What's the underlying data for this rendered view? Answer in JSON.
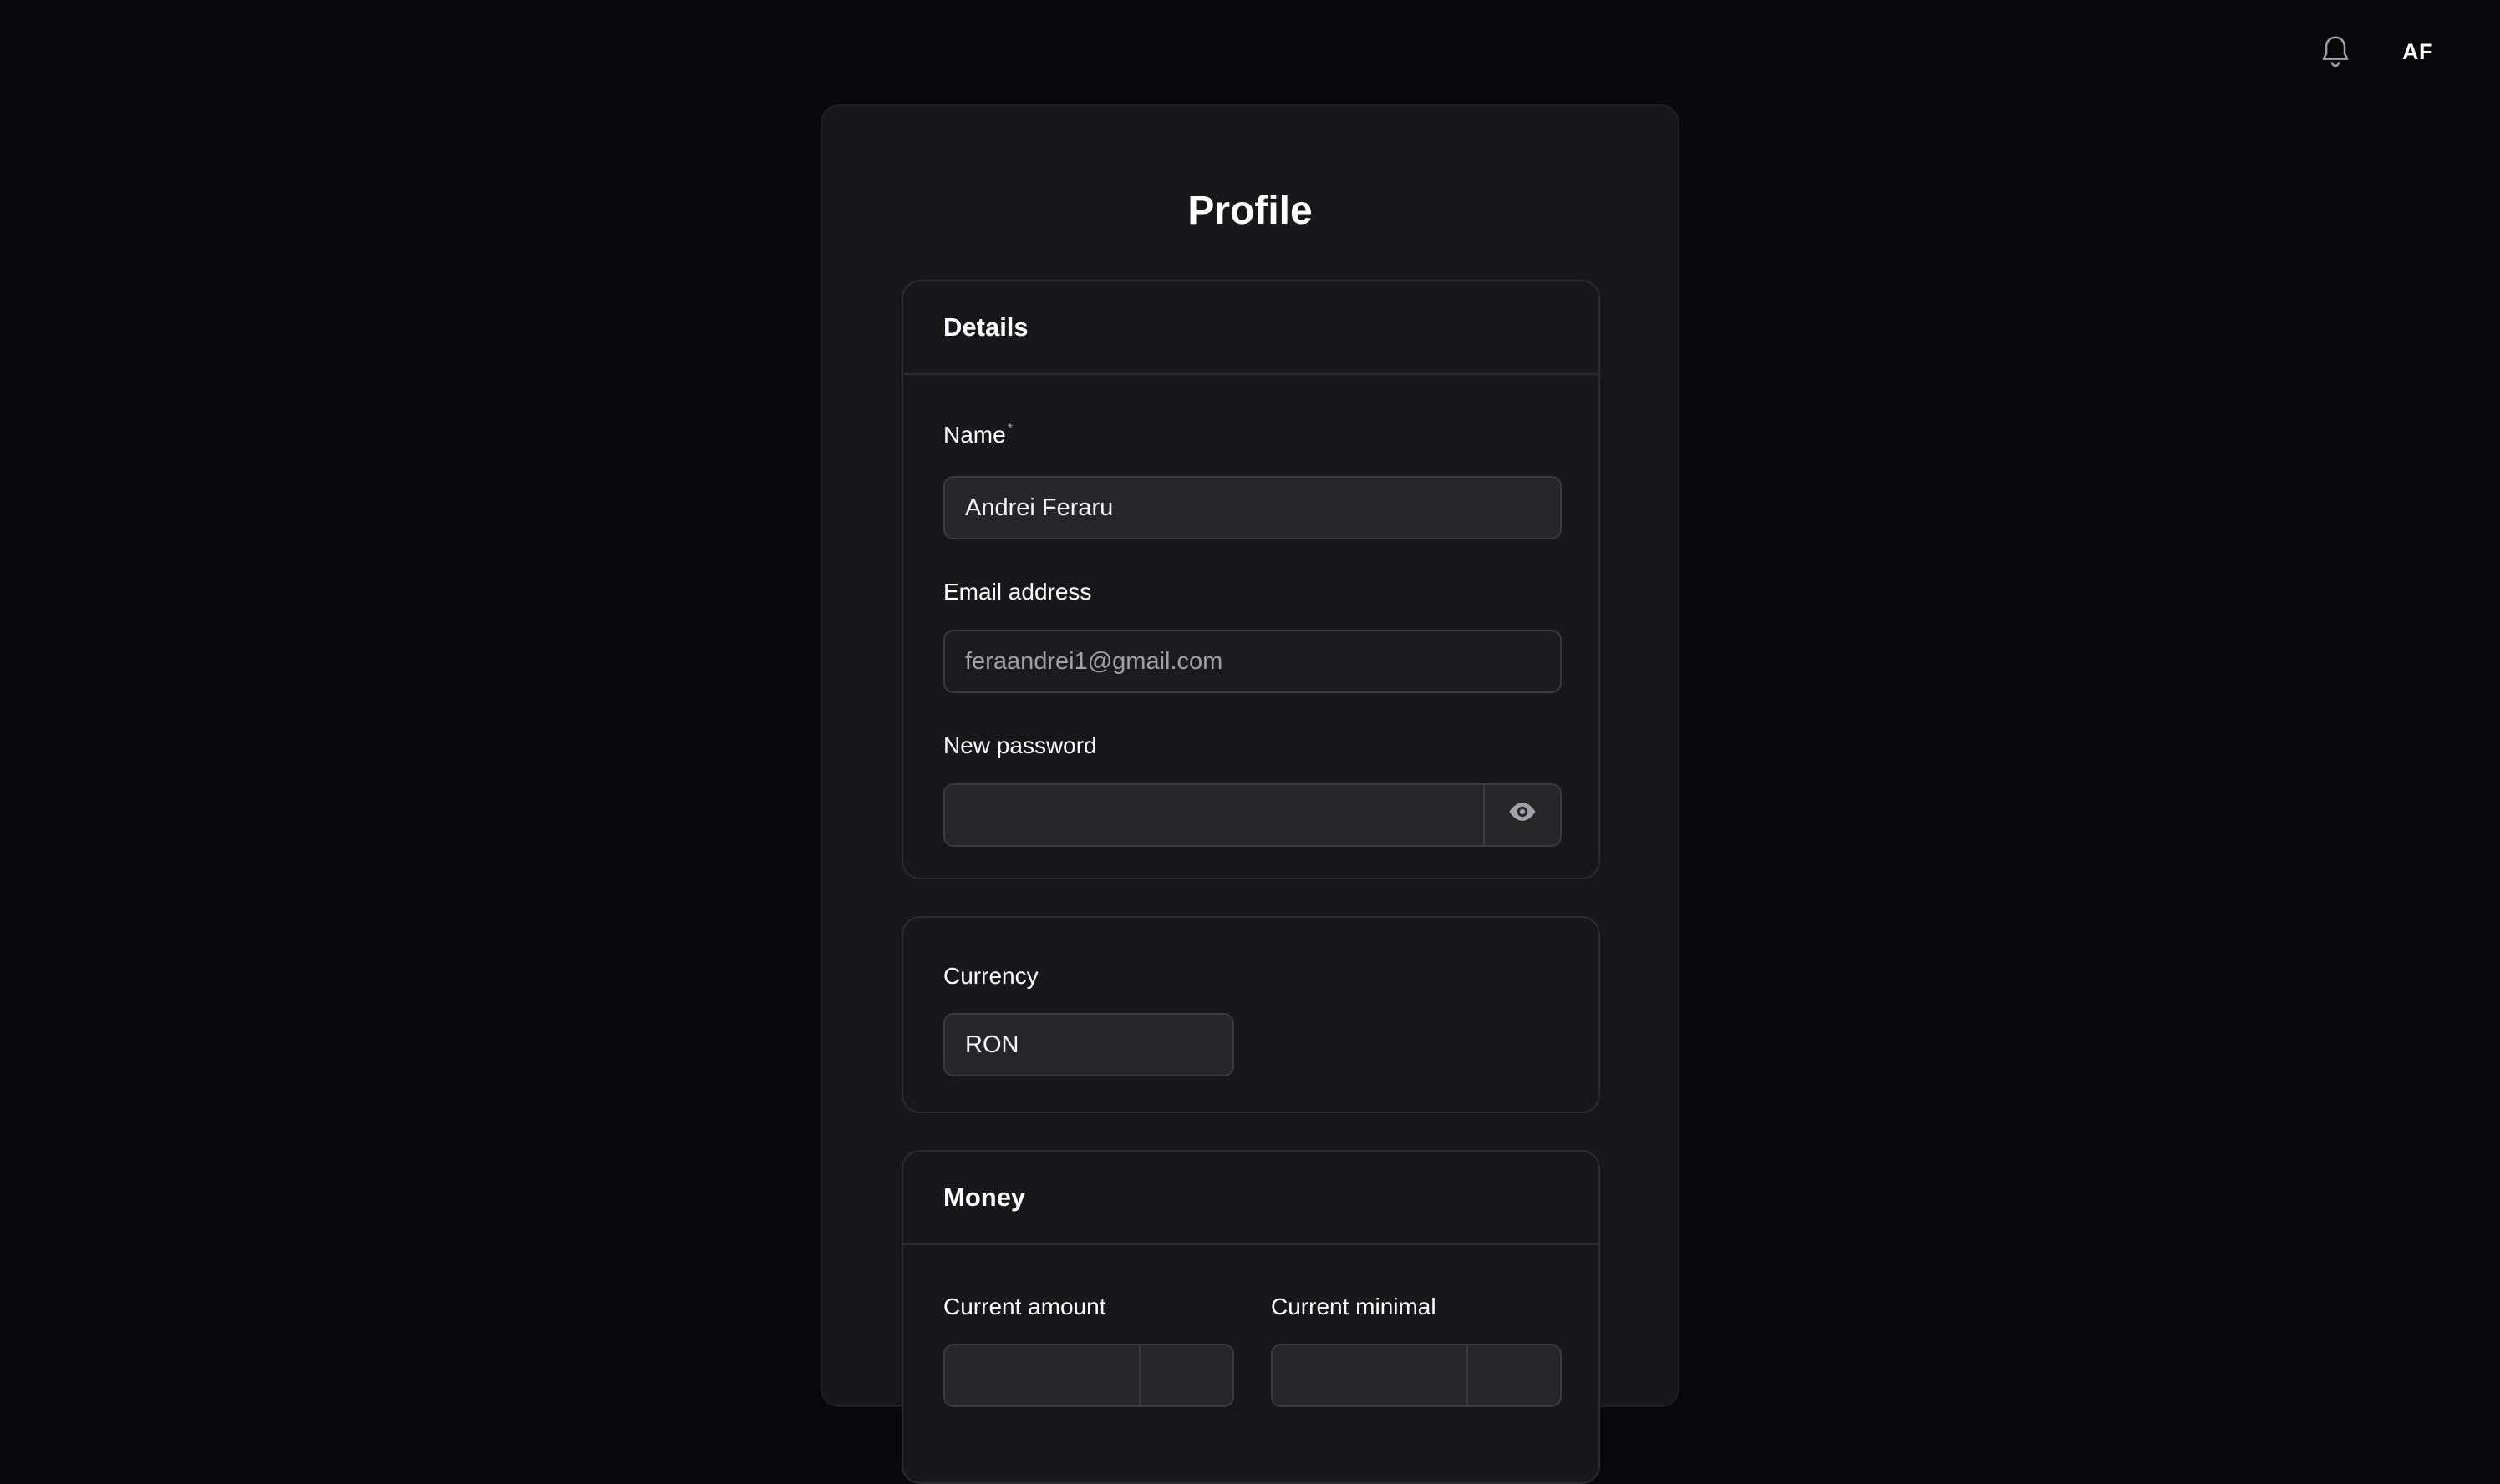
{
  "header": {
    "notification_icon": "bell-icon",
    "avatar_initials": "AF"
  },
  "page": {
    "title": "Profile"
  },
  "details": {
    "title": "Details",
    "name_label": "Name",
    "name_required_mark": "*",
    "name_value": "Andrei Feraru",
    "email_label": "Email address",
    "email_value": "feraandrei1@gmail.com",
    "password_label": "New password",
    "password_value": "",
    "password_toggle_icon": "eye-icon"
  },
  "currency": {
    "label": "Currency",
    "value": "RON"
  },
  "money": {
    "title": "Money",
    "current_amount_label": "Current amount",
    "current_minimal_label": "Current minimal"
  },
  "colors": {
    "background": "#09090b",
    "panel": "#18181b",
    "border": "#2c2c31",
    "input_bg": "#27272a"
  }
}
